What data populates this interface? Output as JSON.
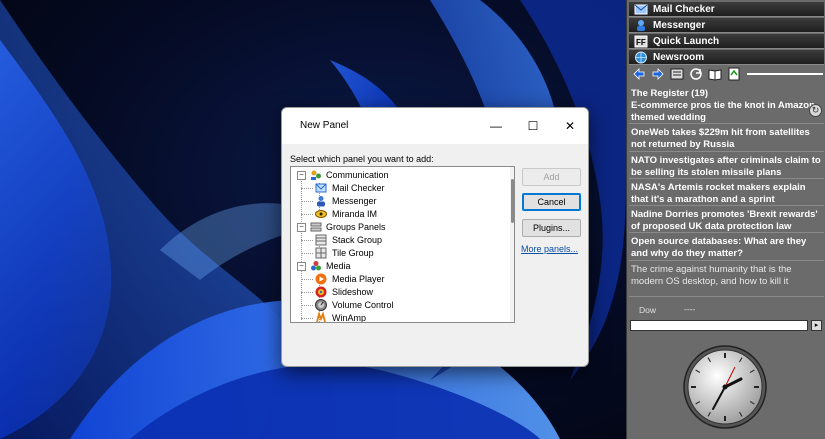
{
  "dialog": {
    "title": "New Panel",
    "prompt": "Select which panel you want to add:",
    "tree": [
      {
        "label": "Communication",
        "level": 0,
        "expanded": true,
        "icon": "communication-icon"
      },
      {
        "label": "Mail Checker",
        "level": 1,
        "icon": "mail-checker-icon"
      },
      {
        "label": "Messenger",
        "level": 1,
        "icon": "messenger-icon"
      },
      {
        "label": "Miranda IM",
        "level": 1,
        "icon": "miranda-icon"
      },
      {
        "label": "Groups Panels",
        "level": 0,
        "expanded": true,
        "icon": "groups-panels-icon"
      },
      {
        "label": "Stack Group",
        "level": 1,
        "icon": "stack-group-icon"
      },
      {
        "label": "Tile Group",
        "level": 1,
        "icon": "tile-group-icon"
      },
      {
        "label": "Media",
        "level": 0,
        "expanded": true,
        "icon": "media-icon"
      },
      {
        "label": "Media Player",
        "level": 1,
        "icon": "media-player-icon"
      },
      {
        "label": "Slideshow",
        "level": 1,
        "icon": "slideshow-icon"
      },
      {
        "label": "Volume Control",
        "level": 1,
        "icon": "volume-control-icon"
      },
      {
        "label": "WinAmp",
        "level": 1,
        "icon": "winamp-icon"
      }
    ],
    "buttons": {
      "add": "Add",
      "cancel": "Cancel",
      "plugins": "Plugins..."
    },
    "more_panels": "More panels...",
    "window_controls": {
      "minimize": "—",
      "maximize": "☐",
      "close": "✕"
    }
  },
  "sidebar": {
    "panels": [
      {
        "label": "Mail Checker",
        "icon": "mail-icon"
      },
      {
        "label": "Messenger",
        "icon": "messenger-icon"
      },
      {
        "label": "Quick Launch",
        "icon": "quick-launch-icon"
      },
      {
        "label": "Newsroom",
        "icon": "globe-icon"
      }
    ],
    "toolbar_icons": [
      "back-arrow-icon",
      "forward-arrow-icon",
      "feeds-icon",
      "refresh-icon",
      "book-icon",
      "recycle-icon"
    ],
    "news": [
      {
        "text": "The Register (19)"
      },
      {
        "text": "E-commerce pros tie the knot in Amazon-themed wedding"
      },
      {
        "text": "OneWeb takes $229m hit from satellites not returned by Russia"
      },
      {
        "text": "NATO investigates after criminals claim to be selling its stolen missile plans"
      },
      {
        "text": "NASA's Artemis rocket makers explain that it's a marathon and a sprint"
      },
      {
        "text": "Nadine Dorries promotes 'Brexit rewards' of proposed UK data protection law"
      },
      {
        "text": "Open source databases: What are they and why do they matter?"
      },
      {
        "text": "The crime against humanity that is the modern OS desktop, and how to kill it"
      }
    ],
    "stock_label": "Dow",
    "stock_value": "----",
    "go_label": "▸"
  },
  "colors": {
    "sidebar_bg": "#6b6b6b",
    "accent": "#0078d4",
    "link": "#0b4fa8"
  }
}
